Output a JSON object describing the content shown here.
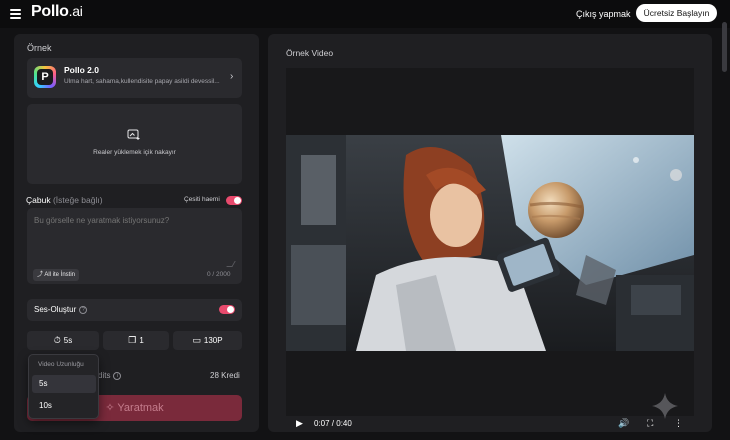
{
  "header": {
    "logo_main": "Pollo",
    "logo_suffix": ".ai",
    "signout": "Çıkış yapmak",
    "start_button": "Ücretsiz Başlayın"
  },
  "left": {
    "section_title": "Örnek",
    "model": {
      "name": "Pollo 2.0",
      "description": "Ulma hart, sahama,kullendisite papay asildi devessil...",
      "logo_letter": "P"
    },
    "upload_text": "Realer yüklemek içik nakayır",
    "prompt": {
      "label": "Çabuk",
      "optional": "(İsteğe bağlı)",
      "diversity_label": "Çesiti haemi",
      "placeholder": "Bu görselle ne yaratmak istiyorsunuz?",
      "share_label": "All ite İnstin",
      "char_count": "0 / 2000"
    },
    "sound": {
      "label": "Ses-Oluştur",
      "info": "?"
    },
    "options": {
      "duration": "5s",
      "count": "1",
      "resolution": "130P",
      "duration_icon": "⏱",
      "count_icon": "❐",
      "resolution_icon": "▭"
    },
    "credits_label": "dits",
    "credits_info": "i",
    "credits_value": "28 Kredi",
    "generate_label": "Yaratmak",
    "generate_icon": "✧",
    "duration_dropdown": {
      "title": "Video Uzunluğu",
      "items": [
        "5s",
        "10s"
      ],
      "selected": "5s"
    },
    "accent": "#e84a6d"
  },
  "right": {
    "title": "Örnek Video",
    "video": {
      "time": "0:07 / 0:40",
      "progress": 0.18,
      "play_icon": "▶",
      "volume_icon": "🔊",
      "fullscreen_icon": "⛶",
      "more_icon": "⋮"
    }
  }
}
